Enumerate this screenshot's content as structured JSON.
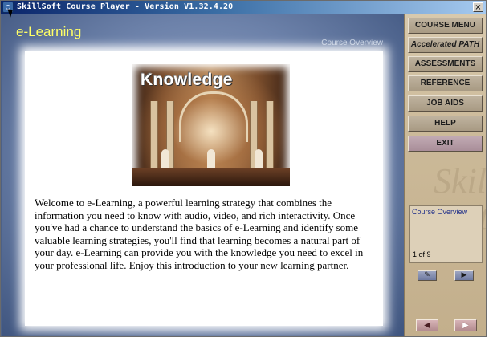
{
  "window": {
    "title": "SkillSoft Course Player - Version V1.32.4.20",
    "close_symbol": "×"
  },
  "header": {
    "app_title": "e-Learning",
    "section_label": "Course Overview"
  },
  "hero": {
    "caption": "Knowledge"
  },
  "content": {
    "body": "Welcome to e-Learning, a powerful learning strategy that combines the information you need to know with audio, video, and rich interactivity. Once you've had a chance to understand the basics of e-Learning and identify some valuable learning strategies, you'll find that learning becomes a natural part of your day. e-Learning can provide you with the knowledge you need to excel in your professional life. Enjoy this introduction to your new learning partner."
  },
  "sidebar": {
    "menu": [
      {
        "label": "COURSE MENU"
      },
      {
        "label": "Accelerated PATH"
      },
      {
        "label": "ASSESSMENTS"
      },
      {
        "label": "REFERENCE"
      },
      {
        "label": "JOB AIDS"
      },
      {
        "label": "HELP"
      },
      {
        "label": "EXIT"
      }
    ],
    "watermark": "Skill Soft",
    "progress": {
      "label": "Course Overview",
      "page_count": "1 of 9"
    },
    "tool_icons": [
      "pencil-icon",
      "play-icon"
    ],
    "nav_icons": [
      "back-arrow-icon",
      "next-arrow-icon"
    ]
  },
  "colors": {
    "title_gradient_start": "#0a246a",
    "app_title": "#ffff66",
    "main_bg": "#6d82aa",
    "sidebar_bg": "#cbb998",
    "progress_label": "#22318a"
  }
}
